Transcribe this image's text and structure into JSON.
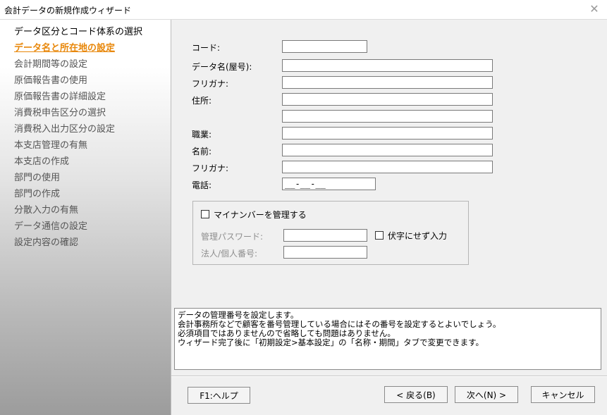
{
  "window": {
    "title": "会計データの新規作成ウィザード"
  },
  "steps": [
    {
      "label": "データ区分とコード体系の選択",
      "state": "done"
    },
    {
      "label": "データ名と所在地の設定",
      "state": "current"
    },
    {
      "label": "会計期間等の設定",
      "state": "normal"
    },
    {
      "label": "原価報告書の使用",
      "state": "normal"
    },
    {
      "label": "原価報告書の詳細設定",
      "state": "normal"
    },
    {
      "label": "消費税申告区分の選択",
      "state": "normal"
    },
    {
      "label": "消費税入出力区分の設定",
      "state": "normal"
    },
    {
      "label": "本支店管理の有無",
      "state": "normal"
    },
    {
      "label": "本支店の作成",
      "state": "normal"
    },
    {
      "label": "部門の使用",
      "state": "normal"
    },
    {
      "label": "部門の作成",
      "state": "normal"
    },
    {
      "label": "分散入力の有無",
      "state": "normal"
    },
    {
      "label": "データ通信の設定",
      "state": "normal"
    },
    {
      "label": "設定内容の確認",
      "state": "normal"
    }
  ],
  "form": {
    "code_label": "コード:",
    "code_value": "",
    "data_name_label": "データ名(屋号):",
    "data_name_value": "",
    "furigana1_label": "フリガナ:",
    "furigana1_value": "",
    "address_label": "住所:",
    "address1_value": "",
    "address2_value": "",
    "occupation_label": "職業:",
    "occupation_value": "",
    "name_label": "名前:",
    "name_value": "",
    "furigana2_label": "フリガナ:",
    "furigana2_value": "",
    "phone_label": "電話:",
    "phone_value": "__-__-__"
  },
  "mynumber": {
    "manage_label": "マイナンバーを管理する",
    "password_label": "管理パスワード:",
    "password_value": "",
    "mask_label": "伏字にせず入力",
    "corp_number_label": "法人/個人番号:",
    "corp_number_value": ""
  },
  "help": {
    "lines": [
      "データの管理番号を設定します。",
      "会計事務所などで顧客を番号管理している場合にはその番号を設定するとよいでしょう。",
      "必須項目ではありませんので省略しても問題はありません。",
      "ウィザード完了後に「初期設定>基本設定」の「名称・期間」タブで変更できます。"
    ]
  },
  "buttons": {
    "help": "F1:ヘルプ",
    "back": "< 戻る(B)",
    "next": "次へ(N) >",
    "cancel": "キャンセル"
  }
}
